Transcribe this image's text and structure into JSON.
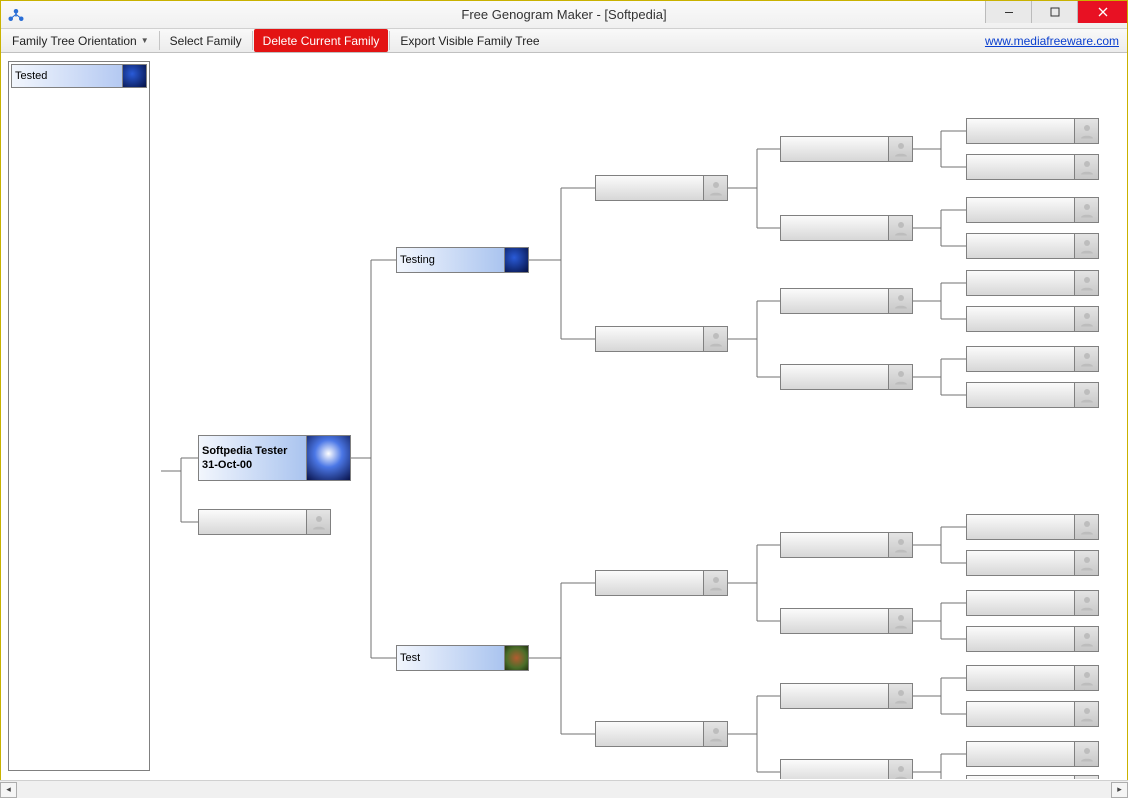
{
  "window": {
    "title": "Free Genogram Maker - [Softpedia]"
  },
  "toolbar": {
    "orientation_label": "Family Tree Orientation",
    "select_family_label": "Select Family",
    "delete_family_label": "Delete Current Family",
    "export_label": "Export Visible Family Tree",
    "link_text": "www.mediafreeware.com"
  },
  "sidebar": {
    "items": [
      {
        "label": "Tested"
      }
    ]
  },
  "tree": {
    "root": {
      "name": "Softpedia Tester",
      "date": "31-Oct-00"
    },
    "root_spouse": {
      "name": ""
    },
    "parents": [
      {
        "name": "Testing"
      },
      {
        "name": "Test"
      }
    ]
  }
}
